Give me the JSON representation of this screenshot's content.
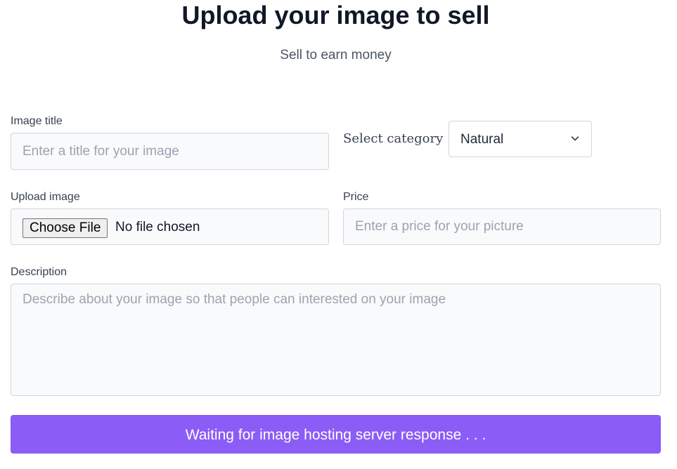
{
  "header": {
    "title": "Upload your image to sell",
    "subtitle": "Sell to earn money"
  },
  "form": {
    "image_title": {
      "label": "Image title",
      "placeholder": "Enter a title for your image",
      "value": ""
    },
    "category": {
      "label": "Select category",
      "selected": "Natural",
      "icon": "chevron-down-icon"
    },
    "upload": {
      "label": "Upload image",
      "button_label": "Choose File",
      "status": "No file chosen"
    },
    "price": {
      "label": "Price",
      "placeholder": "Enter a price for your picture",
      "value": ""
    },
    "description": {
      "label": "Description",
      "placeholder": "Describe about your image so that people can interested on your image",
      "value": ""
    },
    "submit": {
      "label": "Waiting for image hosting server response . . ."
    }
  },
  "colors": {
    "accent": "#8b5cf6",
    "input_background": "#f9fafb",
    "input_border": "#d1d5db"
  }
}
